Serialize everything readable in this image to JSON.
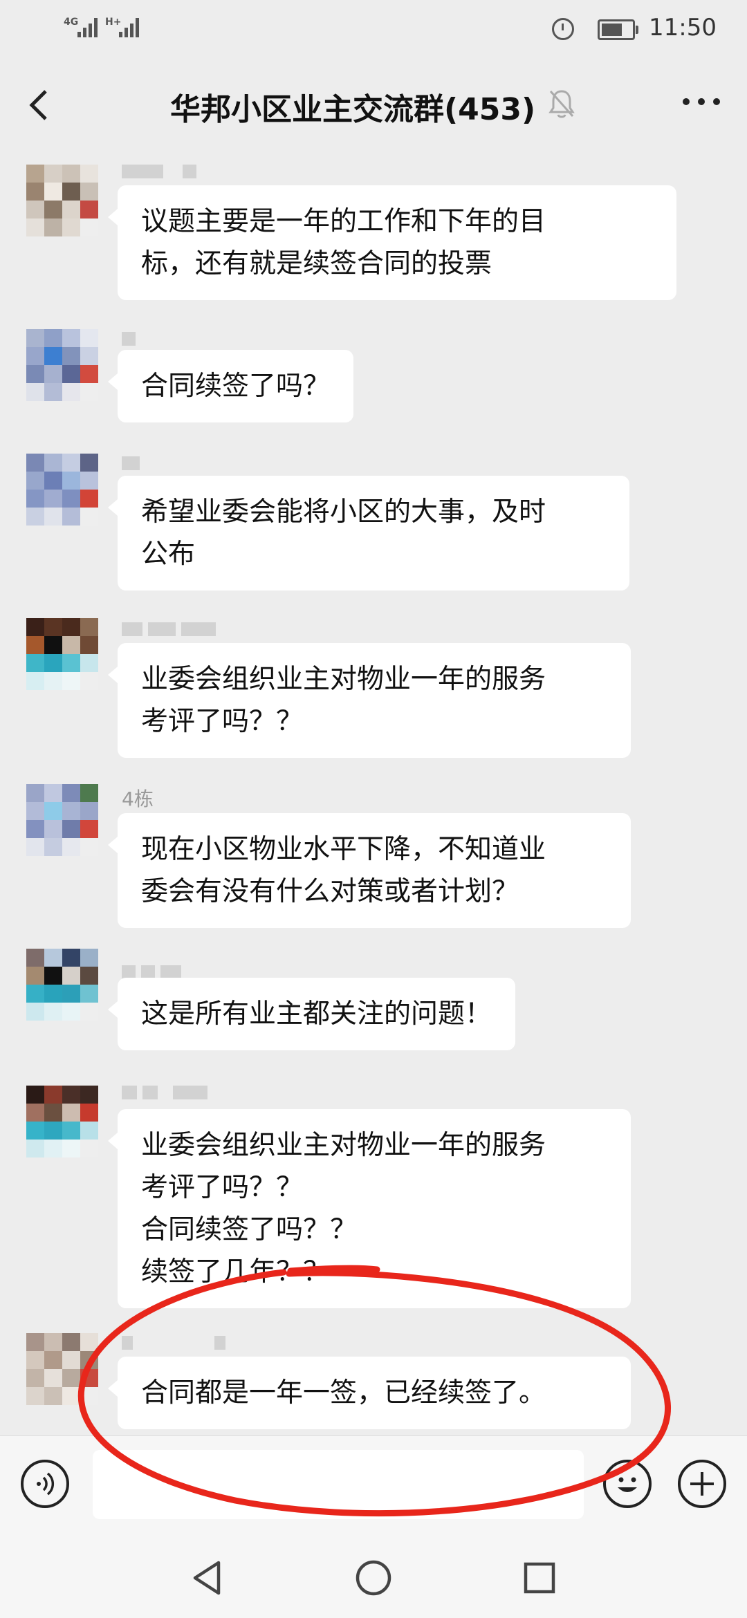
{
  "status_bar": {
    "signal_1": "4G",
    "signal_2": "H+",
    "time": "11:50"
  },
  "header": {
    "title": "华邦小区业主交流群(453)"
  },
  "messages": [
    {
      "sender": "",
      "text": "议题主要是一年的工作和下年的目\n标，还有就是续签合同的投票"
    },
    {
      "sender": "",
      "text": "合同续签了吗？"
    },
    {
      "sender": "",
      "text": "希望业委会能将小区的大事，及时\n公布"
    },
    {
      "sender": "",
      "text": "业委会组织业主对物业一年的服务\n考评了吗？？"
    },
    {
      "sender": "4栋",
      "text": "现在小区物业水平下降，不知道业\n委会有没有什么对策或者计划？"
    },
    {
      "sender": "",
      "text": "这是所有业主都关注的问题！"
    },
    {
      "sender": "",
      "text": "业委会组织业主对物业一年的服务\n考评了吗？？\n合同续签了吗？？\n续签了几年？？"
    },
    {
      "sender": "",
      "text": "合同都是一年一签，已经续签了。"
    }
  ],
  "input_bar": {
    "voice_icon": "voice-icon",
    "emoji_icon": "emoji-icon",
    "plus_icon": "plus-icon"
  },
  "annotation": {
    "color": "#e8261b"
  }
}
